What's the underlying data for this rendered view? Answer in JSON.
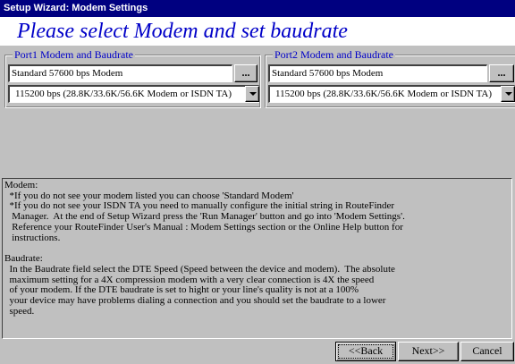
{
  "window": {
    "title": "Setup Wizard: Modem Settings"
  },
  "heading": "Please select Modem and set baudrate",
  "port1": {
    "legend": "Port1 Modem and Baudrate",
    "modem_value": "Standard 57600 bps Modem",
    "browse_label": "...",
    "baud_value": "115200 bps (28.8K/33.6K/56.6K Modem or ISDN TA)"
  },
  "port2": {
    "legend": "Port2 Modem and Baudrate",
    "modem_value": "Standard 57600 bps Modem",
    "browse_label": "...",
    "baud_value": "115200 bps (28.8K/33.6K/56.6K Modem or ISDN TA)"
  },
  "info": {
    "modem_heading": "Modem:",
    "modem_lines": [
      "  *If you do not see your modem listed you can choose 'Standard Modem'",
      "  *If you do not see your ISDN TA you need to manually configure the initial string in RouteFinder",
      "   Manager.  At the end of Setup Wizard press the 'Run Manager' button and go into 'Modem Settings'.",
      "   Reference your RouteFinder User's Manual : Modem Settings section or the Online Help button for",
      "   instructions."
    ],
    "baud_heading": "Baudrate:",
    "baud_lines": [
      "  In the Baudrate field select the DTE Speed (Speed between the device and modem).  The absolute",
      "  maximum setting for a 4X compression modem with a very clear connection is 4X the speed",
      "  of your modem. If the DTE baudrate is set to hight or your line's quality is not at a 100%",
      "  your device may have problems dialing a connection and you should set the baudrate to a lower",
      "  speed."
    ]
  },
  "buttons": {
    "back": "<<Back",
    "next": "Next>>",
    "cancel": "Cancel"
  }
}
